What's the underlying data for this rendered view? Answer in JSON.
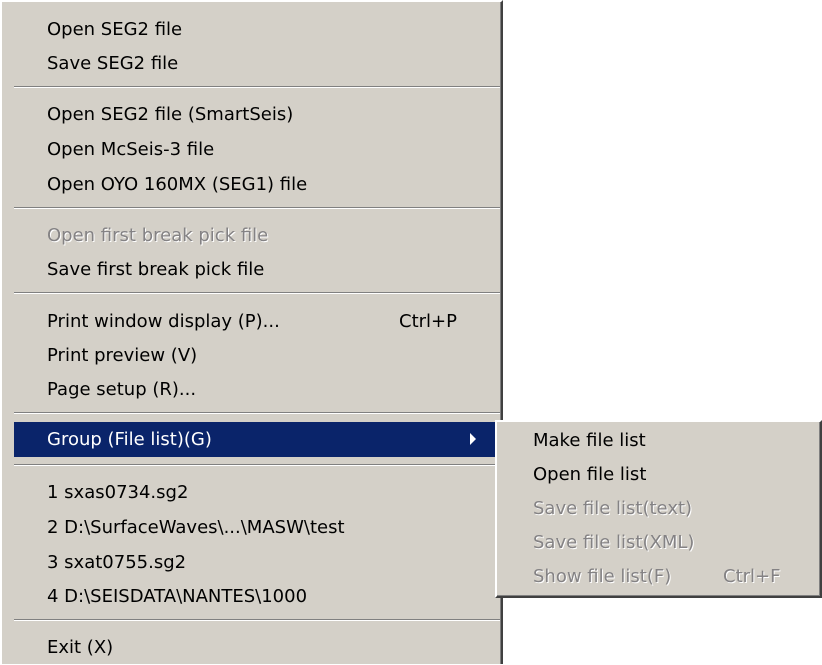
{
  "menu": {
    "items": [
      {
        "label": "Open SEG2 file"
      },
      {
        "label": "Save SEG2 file"
      },
      {
        "label": "Open SEG2 file (SmartSeis)"
      },
      {
        "label": "Open McSeis-3 file"
      },
      {
        "label": "Open OYO 160MX (SEG1) file"
      },
      {
        "label": "Open first break pick file"
      },
      {
        "label": "Save first break pick file"
      },
      {
        "label": "Print window display (P)...",
        "shortcut": "Ctrl+P"
      },
      {
        "label": "Print preview (V)"
      },
      {
        "label": "Page setup (R)..."
      },
      {
        "label": "Group (File list)(G)"
      },
      {
        "label": "1 sxas0734.sg2"
      },
      {
        "label": "2 D:\\SurfaceWaves\\...\\MASW\\test"
      },
      {
        "label": "3 sxat0755.sg2"
      },
      {
        "label": "4 D:\\SEISDATA\\NANTES\\1000"
      },
      {
        "label": "Exit (X)"
      }
    ]
  },
  "submenu": {
    "items": [
      {
        "label": "Make file list"
      },
      {
        "label": "Open file list"
      },
      {
        "label": "Save file list(text)"
      },
      {
        "label": "Save file list(XML)"
      },
      {
        "label": "Show file list(F)",
        "shortcut": "Ctrl+F"
      }
    ]
  },
  "colors": {
    "menu_bg": "#d4d0c8",
    "highlight_bg": "#0a246a",
    "disabled_text": "#848284"
  }
}
